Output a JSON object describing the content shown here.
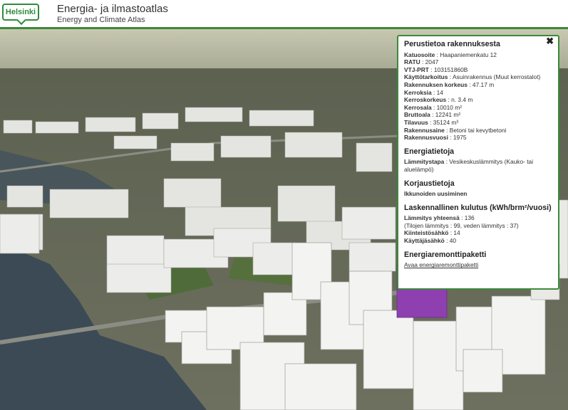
{
  "header": {
    "logo_text": "Helsinki",
    "title_fi": "Energia- ja ilmastoatlas",
    "title_en": "Energy and Climate Atlas"
  },
  "popup": {
    "close_label": "✖",
    "basic": {
      "heading": "Perustietoa rakennuksesta",
      "rows": [
        {
          "label": "Katuosoite",
          "value": ": Haapaniemenkatu 12"
        },
        {
          "label": "RATU",
          "value": ": 2047"
        },
        {
          "label": "VTJ-PRT",
          "value": ": 103151860B"
        },
        {
          "label": "Käyttötarkoitus",
          "value": ": Asuinrakennus (Muut kerrostalot)"
        },
        {
          "label": "Rakennuksen korkeus",
          "value": ": 47.17 m"
        },
        {
          "label": "Kerroksia",
          "value": ": 14"
        },
        {
          "label": "Kerroskorkeus",
          "value": ": n. 3.4 m"
        },
        {
          "label": "Kerrosala",
          "value": ": 10010 m²"
        },
        {
          "label": "Bruttoala",
          "value": ": 12241 m²"
        },
        {
          "label": "Tilavuus",
          "value": ": 35124 m³"
        },
        {
          "label": "Rakennusaine",
          "value": ": Betoni tai kevytbetoni"
        },
        {
          "label": "Rakennusvuosi",
          "value": ": 1975"
        }
      ]
    },
    "energy": {
      "heading": "Energiatietoja",
      "label": "Lämmitystapa",
      "value": ": Vesikeskuslämmitys (Kauko- tai aluelämpö)"
    },
    "repairs": {
      "heading": "Korjaustietoja",
      "value": "Ikkunoiden uusiminen"
    },
    "consumption": {
      "heading": "Laskennallinen kulutus (kWh/brm²/vuosi)",
      "heating_total_label": "Lämmitys yhteensä",
      "heating_total_value": ": 136",
      "heating_detail": "(Tilojen lämmitys : 99, veden lämmitys : 37)",
      "property_elec_label": "Kiinteistösähkö",
      "property_elec_value": ": 14",
      "user_elec_label": "Käyttäjäsähkö",
      "user_elec_value": ": 40"
    },
    "renovation": {
      "heading": "Energiaremonttipaketti",
      "link": "Avaa energiaremonttipaketti"
    }
  }
}
